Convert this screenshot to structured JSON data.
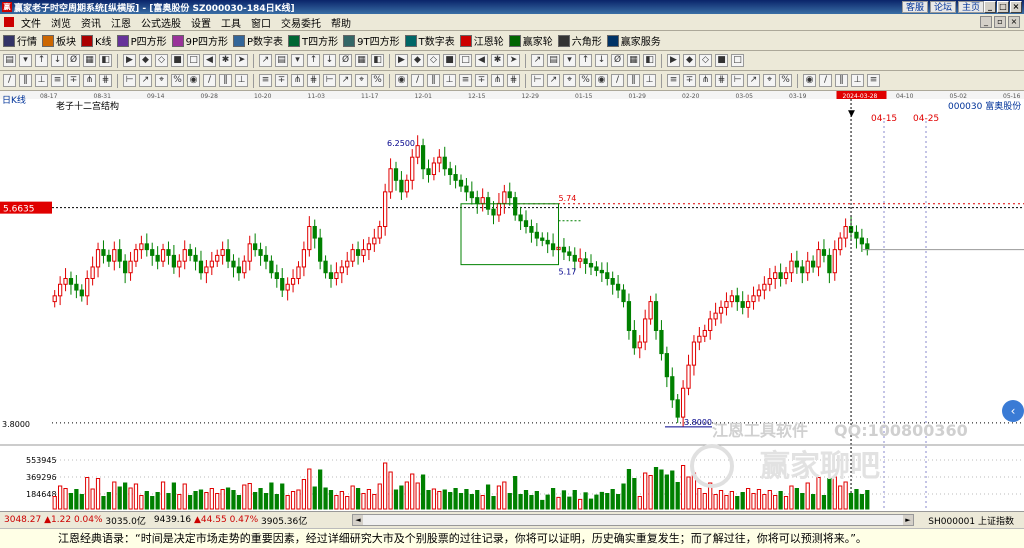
{
  "window": {
    "title": "赢家老子时空周期系统[纵横版] - [富奥股份  SZ000030-184日K线]",
    "links": [
      "客服",
      "论坛",
      "主页"
    ],
    "controls": [
      "_",
      "□",
      "×"
    ]
  },
  "menu": [
    "文件",
    "浏览",
    "资讯",
    "江恩",
    "公式选股",
    "设置",
    "工具",
    "窗口",
    "交易委托",
    "帮助"
  ],
  "toolbar": [
    {
      "icon": "grid-icon",
      "label": "行情"
    },
    {
      "icon": "blocks-icon",
      "label": "板块"
    },
    {
      "icon": "kline-icon",
      "label": "K线"
    },
    {
      "icon": "p-square-icon",
      "label": "P四方形"
    },
    {
      "icon": "9p-square-icon",
      "label": "9P四方形"
    },
    {
      "icon": "p-number-icon",
      "label": "P数字表"
    },
    {
      "icon": "t-square-icon",
      "label": "T四方形"
    },
    {
      "icon": "9t-square-icon",
      "label": "9T四方形"
    },
    {
      "icon": "t-number-icon",
      "label": "T数字表"
    },
    {
      "icon": "gann-wheel-icon",
      "label": "江恩轮"
    },
    {
      "icon": "winner-wheel-icon",
      "label": "赢家轮"
    },
    {
      "icon": "hexagram-icon",
      "label": "六角形"
    },
    {
      "icon": "service-icon",
      "label": "赢家服务"
    }
  ],
  "chart_data": {
    "type": "candlestick",
    "period_label": "日K线",
    "indicator_label": "老子十二宫结构",
    "stock_label": "000030  富奥股份",
    "dates": [
      "08-17",
      "08-31",
      "09-14",
      "09-28",
      "10-20",
      "11-03",
      "11-17",
      "12-01",
      "12-15",
      "12-29",
      "01-15",
      "01-29",
      "02-20",
      "03-05",
      "03-19",
      "2024-03-28",
      "04-10",
      "05-02",
      "05-16"
    ],
    "current_date": "2024-03-28",
    "current_price": "5.6635",
    "annotations": [
      "6.2500",
      "5.74",
      "5.17",
      "3.8000",
      "04-15",
      "04-25"
    ],
    "axis_price": "3.8000",
    "volume_ticks": [
      "553945",
      "369296",
      "184648"
    ],
    "box": {
      "top": 5.74,
      "bottom": 5.17
    },
    "ylim": [
      3.6,
      6.5
    ],
    "closes": [
      4.9,
      5.0,
      5.05,
      5.0,
      4.95,
      4.9,
      5.05,
      5.15,
      5.3,
      5.25,
      5.2,
      5.3,
      5.2,
      5.1,
      5.2,
      5.3,
      5.35,
      5.3,
      5.25,
      5.2,
      5.3,
      5.25,
      5.15,
      5.2,
      5.3,
      5.25,
      5.2,
      5.1,
      5.15,
      5.2,
      5.25,
      5.3,
      5.2,
      5.15,
      5.1,
      5.2,
      5.35,
      5.3,
      5.25,
      5.2,
      5.1,
      5.05,
      4.95,
      5.0,
      5.05,
      5.15,
      5.3,
      5.5,
      5.4,
      5.2,
      5.1,
      5.05,
      5.1,
      5.15,
      5.2,
      5.3,
      5.25,
      5.3,
      5.35,
      5.4,
      5.5,
      5.8,
      6.0,
      5.9,
      5.8,
      5.9,
      6.1,
      6.2,
      6.0,
      5.95,
      6.05,
      6.1,
      6.0,
      5.95,
      5.9,
      5.85,
      5.8,
      5.75,
      5.7,
      5.75,
      5.65,
      5.6,
      5.7,
      5.8,
      5.75,
      5.6,
      5.55,
      5.5,
      5.45,
      5.4,
      5.38,
      5.35,
      5.3,
      5.32,
      5.28,
      5.25,
      5.2,
      5.22,
      5.18,
      5.15,
      5.12,
      5.1,
      5.05,
      5.0,
      4.95,
      4.85,
      4.6,
      4.45,
      4.5,
      4.7,
      4.85,
      4.6,
      4.4,
      4.2,
      4.0,
      3.85,
      4.1,
      4.3,
      4.5,
      4.55,
      4.6,
      4.7,
      4.75,
      4.8,
      4.85,
      4.9,
      4.85,
      4.8,
      4.85,
      4.9,
      4.95,
      5.0,
      5.05,
      5.1,
      5.05,
      5.1,
      5.2,
      5.15,
      5.1,
      5.2,
      5.15,
      5.3,
      5.25,
      5.1,
      5.3,
      5.4,
      5.5,
      5.45,
      5.4,
      5.35,
      5.3
    ]
  },
  "status": {
    "idx1_val": "3048.27",
    "idx1_chg": "▲1.22",
    "idx1_pct": "0.04%",
    "idx1_amt": "3035.0亿",
    "idx2_val": "9439.16",
    "idx2_chg": "▲44.55",
    "idx2_pct": "0.47%",
    "idx2_amt": "3905.36亿",
    "sh_label": "SH000001 上证指数"
  },
  "quote": "江恩经典语录：“时间是决定市场走势的重要因素，经过详细研究大市及个别股票的过往记录，你将可以证明，历史确实重复发生；而了解过往，你将可以预测将来。”。",
  "watermark": {
    "brand": "江恩工具软件",
    "qq": "QQ:100800360",
    "site": "赢家聊吧"
  },
  "colors": {
    "up": "#e00000",
    "down": "#008000",
    "title": "#0a246a",
    "bg": "#ffffff"
  }
}
